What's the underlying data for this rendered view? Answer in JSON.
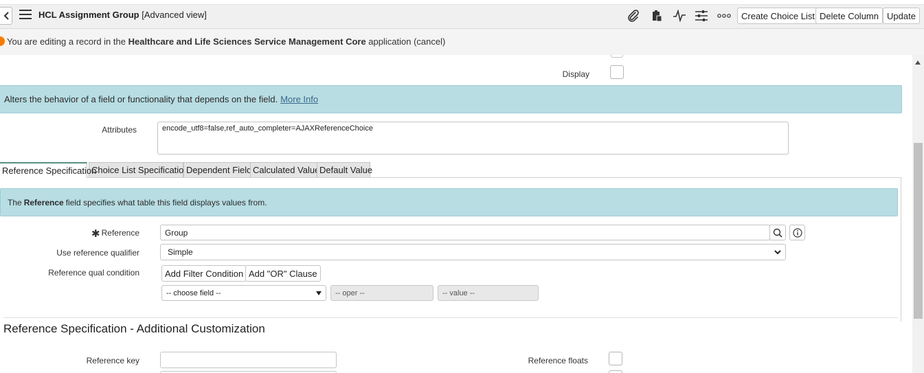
{
  "header": {
    "title_bold": "HCL Assignment Group",
    "title_suffix": " [Advanced view]",
    "buttons": {
      "create_choice_list": "Create Choice List",
      "delete_column": "Delete Column",
      "update": "Update"
    },
    "icons": [
      "back-icon",
      "hamburger-menu-icon",
      "paperclip-icon",
      "clipboard-icon",
      "activity-icon",
      "sliders-icon",
      "more-options-icon"
    ]
  },
  "notice": {
    "prefix": "You are editing a record in the ",
    "app_name": "Healthcare and Life Sciences Service Management Core",
    "suffix": " application ",
    "cancel_link": "(cancel)",
    "dot_color": "#f27d0c"
  },
  "form": {
    "display_label": "Display",
    "attributes_info": "Alters the behavior of a field or functionality that depends on the field.",
    "more_info_link": "More Info",
    "attributes_label": "Attributes",
    "attributes_value": "encode_utf8=false,ref_auto_completer=AJAXReferenceChoice"
  },
  "tabs": [
    {
      "label": "Reference Specification",
      "active": true
    },
    {
      "label": "Choice List Specification",
      "active": false
    },
    {
      "label": "Dependent Field",
      "active": false
    },
    {
      "label": "Calculated Value",
      "active": false
    },
    {
      "label": "Default Value",
      "active": false
    }
  ],
  "reference_spec": {
    "info_prefix": "The ",
    "info_bold": "Reference",
    "info_suffix": " field specifies what table this field displays values from.",
    "required_marker": "✱",
    "reference_label": "Reference",
    "reference_value": "Group",
    "use_qualifier_label": "Use reference qualifier",
    "use_qualifier_value": "Simple",
    "qual_condition_label": "Reference qual condition",
    "add_filter_btn": "Add Filter Condition",
    "add_or_btn": "Add \"OR\" Clause",
    "choose_field": "-- choose field --",
    "oper": "-- oper --",
    "value": "-- value --"
  },
  "additional": {
    "section_title": "Reference Specification - Additional Customization",
    "reference_key_label": "Reference key",
    "reference_key_value": "",
    "reference_floats_label": "Reference floats"
  },
  "colors": {
    "info_bg": "#b8dde3",
    "tab_active_border": "#5a8f85",
    "header_bg": "#f0f0f0"
  }
}
